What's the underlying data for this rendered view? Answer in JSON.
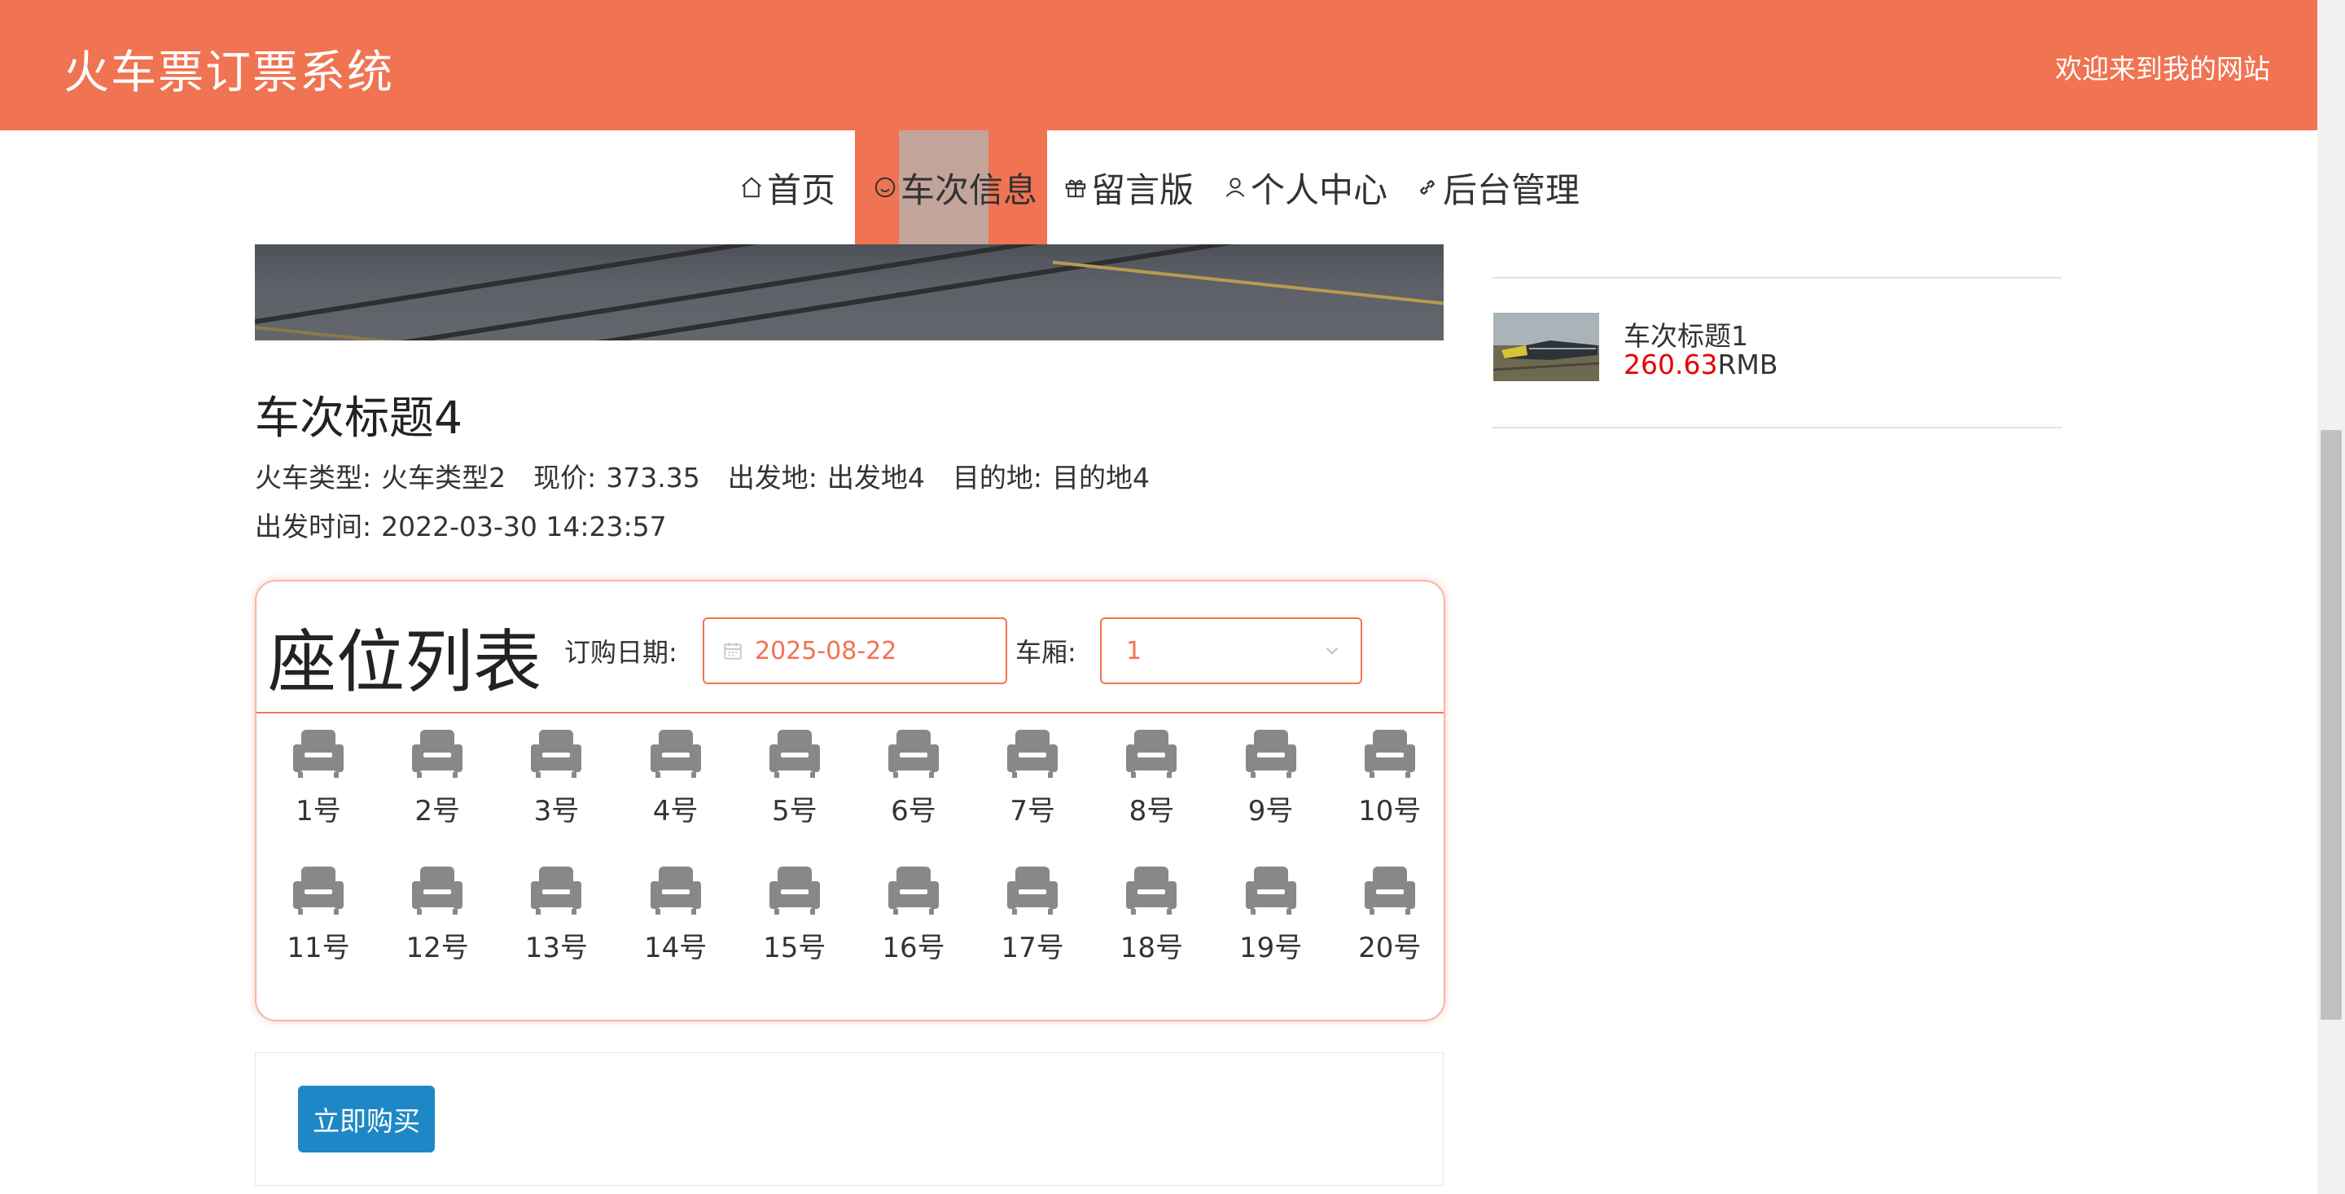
{
  "header": {
    "site_title": "火车票订票系统",
    "welcome": "欢迎来到我的网站"
  },
  "nav": {
    "items": [
      {
        "label": "首页",
        "icon": "home-icon"
      },
      {
        "label": "车次信息",
        "icon": "smile-icon",
        "active": true
      },
      {
        "label": "留言版",
        "icon": "gift-icon"
      },
      {
        "label": "个人中心",
        "icon": "user-icon"
      },
      {
        "label": "后台管理",
        "icon": "link-icon"
      }
    ]
  },
  "train": {
    "title": "车次标题4",
    "type_label": "火车类型:",
    "type_value": "火车类型2",
    "price_label": "现价:",
    "price_value": "373.35",
    "from_label": "出发地:",
    "from_value": "出发地4",
    "to_label": "目的地:",
    "to_value": "目的地4",
    "time_label": "出发时间:",
    "time_value": "2022-03-30 14:23:57"
  },
  "seats": {
    "title": "座位列表",
    "date_label": "订购日期:",
    "date_value": "2025-08-22",
    "car_label": "车厢:",
    "car_value": "1",
    "items": [
      "1号",
      "2号",
      "3号",
      "4号",
      "5号",
      "6号",
      "7号",
      "8号",
      "9号",
      "10号",
      "11号",
      "12号",
      "13号",
      "14号",
      "15号",
      "16号",
      "17号",
      "18号",
      "19号",
      "20号"
    ]
  },
  "buy": {
    "button": "立即购买"
  },
  "sidebar": {
    "items": [
      {
        "title": "车次标题1",
        "price": "260.63",
        "currency": "RMB"
      }
    ]
  },
  "colors": {
    "brand": "#f07352",
    "button": "#1e88c6",
    "price": "#e60000"
  }
}
